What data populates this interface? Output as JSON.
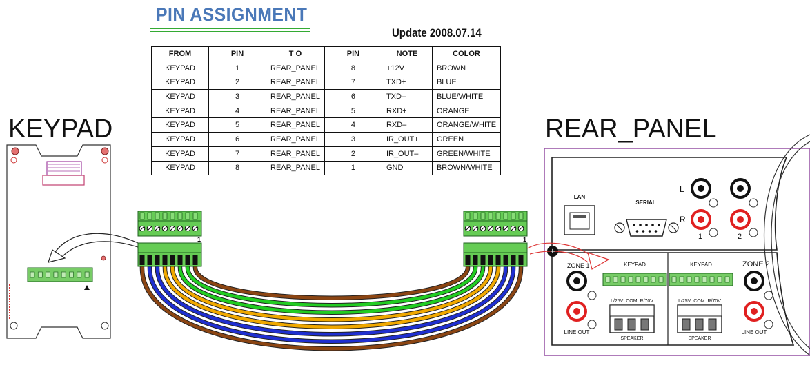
{
  "heading": {
    "title": "PIN ASSIGNMENT",
    "update": "Update 2008.07.14"
  },
  "table": {
    "headers": [
      "FROM",
      "PIN",
      "T O",
      "PIN",
      "NOTE",
      "COLOR"
    ],
    "rows": [
      [
        "KEYPAD",
        "1",
        "REAR_PANEL",
        "8",
        "+12V",
        "BROWN"
      ],
      [
        "KEYPAD",
        "2",
        "REAR_PANEL",
        "7",
        "TXD+",
        "BLUE"
      ],
      [
        "KEYPAD",
        "3",
        "REAR_PANEL",
        "6",
        "TXD–",
        "BLUE/WHITE"
      ],
      [
        "KEYPAD",
        "4",
        "REAR_PANEL",
        "5",
        "RXD+",
        "ORANGE"
      ],
      [
        "KEYPAD",
        "5",
        "REAR_PANEL",
        "4",
        "RXD–",
        "ORANGE/WHITE"
      ],
      [
        "KEYPAD",
        "6",
        "REAR_PANEL",
        "3",
        "IR_OUT+",
        "GREEN"
      ],
      [
        "KEYPAD",
        "7",
        "REAR_PANEL",
        "2",
        "IR_OUT–",
        "GREEN/WHITE"
      ],
      [
        "KEYPAD",
        "8",
        "REAR_PANEL",
        "1",
        "GND",
        "BROWN/WHITE"
      ]
    ]
  },
  "keypad": {
    "label": "KEYPAD"
  },
  "connector": {
    "pin_one_left": "1",
    "pin_one_right": "1"
  },
  "rear_panel": {
    "label": "REAR_PANEL",
    "lan": "LAN",
    "serial": "SERIAL",
    "left_channel": "L",
    "right_channel": "R",
    "input_one": "1",
    "input_two": "2",
    "zone1": "ZONE 1",
    "zone2": "ZONE 2",
    "keypad_port_1": "KEYPAD",
    "keypad_port_2": "KEYPAD",
    "speaker_taps_1": "L/25V  COM  R/70V",
    "speaker_taps_2": "L/25V  COM  R/70V",
    "speaker_1": "SPEAKER",
    "speaker_2": "SPEAKER",
    "line_out_1": "LINE OUT",
    "line_out_2": "LINE OUT",
    "plus_symbol": "+"
  },
  "wire_colors": [
    "#8b4513",
    "#1f2fd0",
    "#1f2fd0",
    "#f0a800",
    "#f0a800",
    "#22cc22",
    "#22cc22",
    "#8b4513"
  ],
  "accent_colors": {
    "title_blue": "#4a78b8",
    "connector_green": "#44b544",
    "panel_purple": "#9b5aa8",
    "rca_red": "#e02020"
  }
}
